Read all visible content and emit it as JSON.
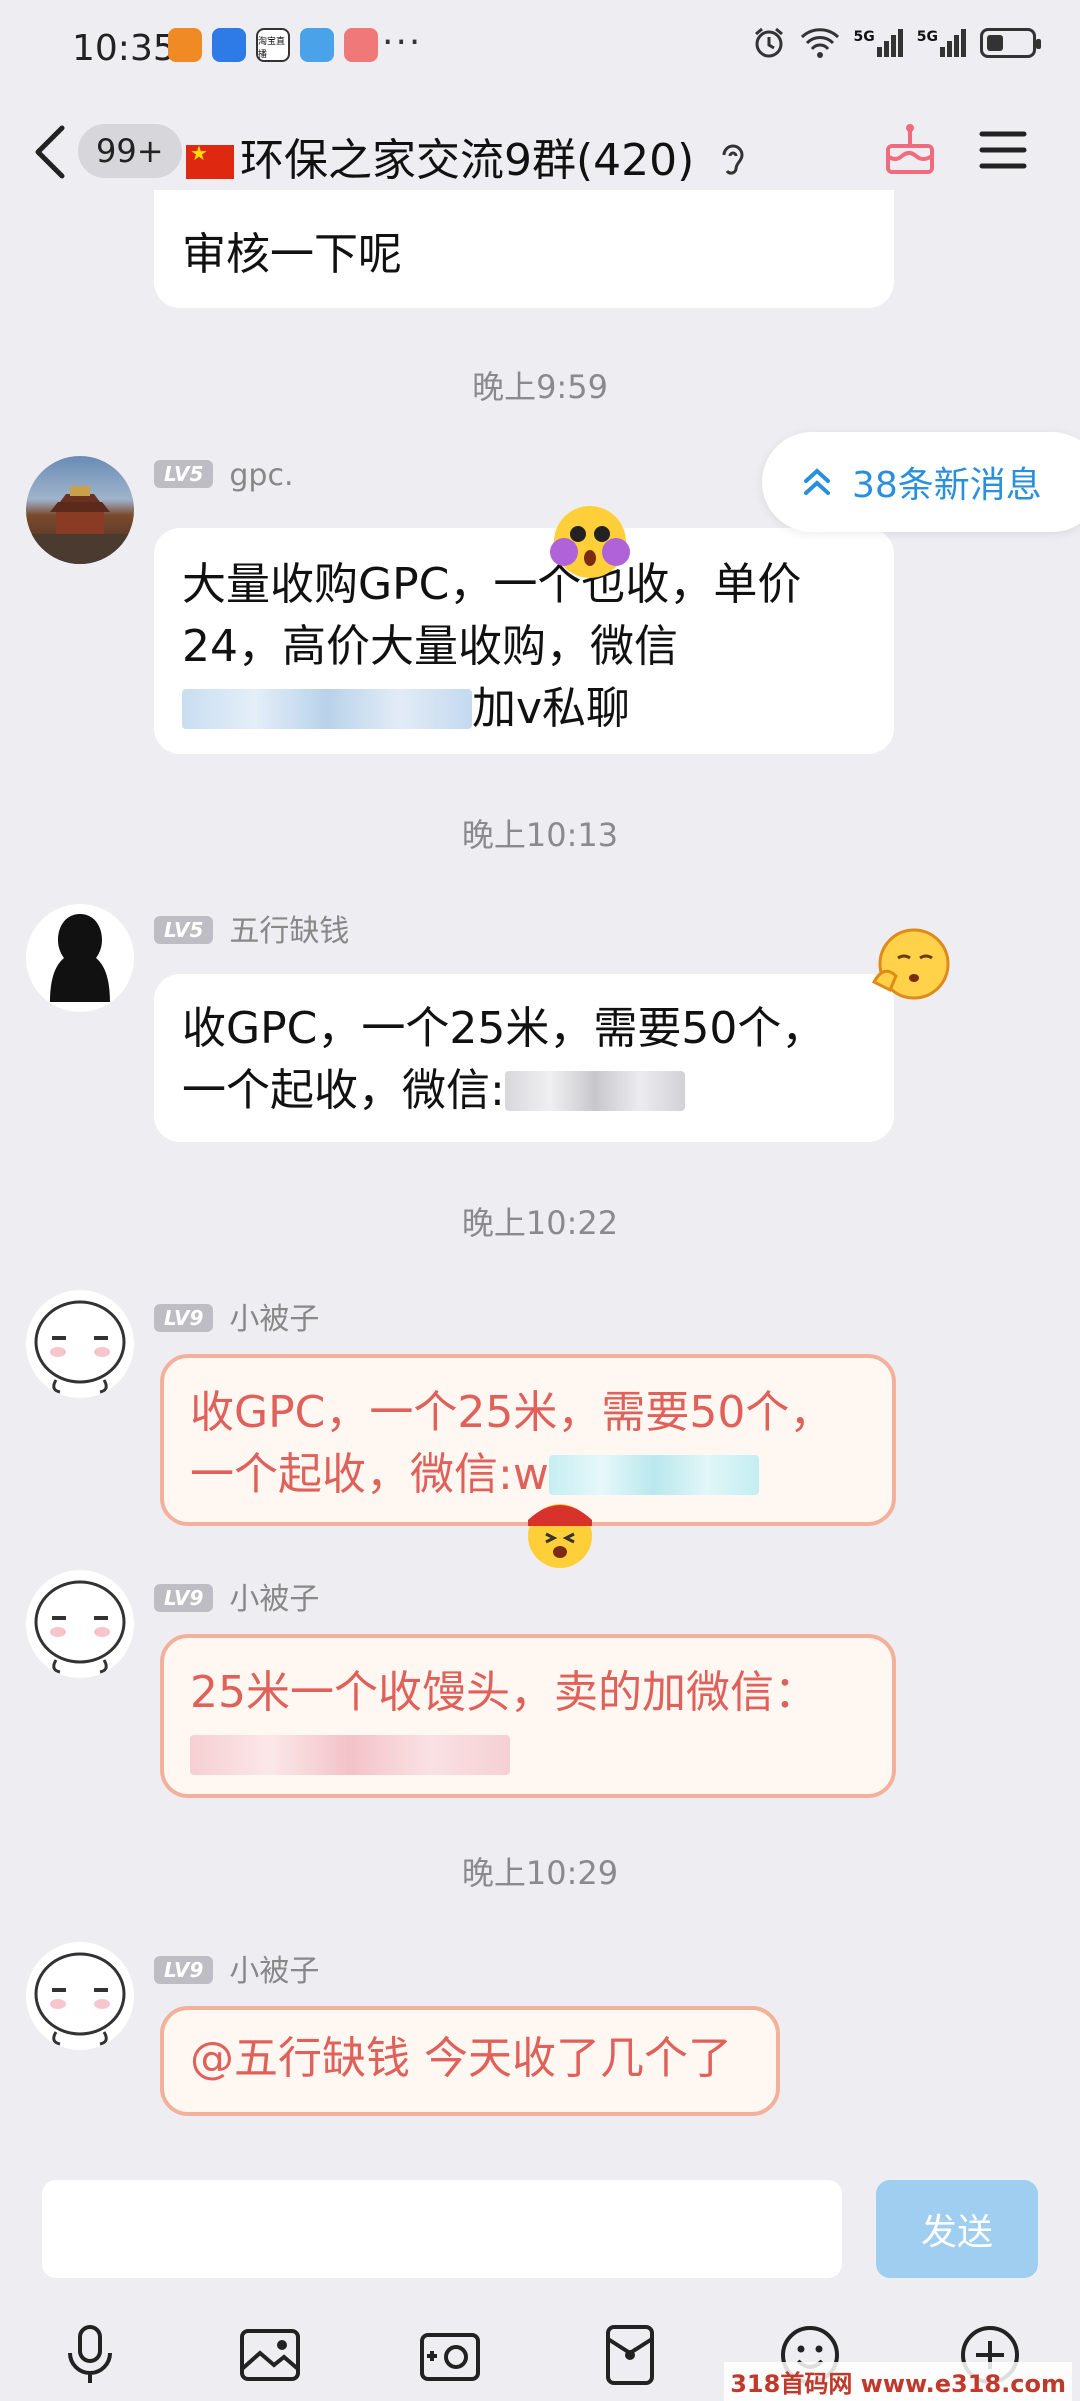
{
  "status_bar": {
    "time": "10:35",
    "app_label": "淘宝直播",
    "dots": "···",
    "net1": "5G",
    "net2": "5G"
  },
  "header": {
    "back_icon": "back-arrow-icon",
    "unread_badge": "99+",
    "group_title": "环保之家交流9群(420)",
    "ear_icon": "ear-icon",
    "cake_icon": "cake-icon",
    "menu_icon": "hamburger-menu-icon"
  },
  "new_messages_pill": "38条新消息",
  "messages": [
    {
      "text": "审核一下呢"
    },
    {
      "time": "晚上9:59"
    },
    {
      "level": "LV5",
      "user": "gpc.",
      "line1": "大量收购GPC，一个也收，单价",
      "line2": "24，高价大量收购，微信",
      "line3_tail": "加v私聊"
    },
    {
      "time": "晚上10:13"
    },
    {
      "level": "LV5",
      "user": "五行缺钱",
      "line1": "收GPC，一个25米，需要50个，",
      "line2_head": "一个起收，微信:"
    },
    {
      "time": "晚上10:22"
    },
    {
      "level": "LV9",
      "user": "小被子",
      "line1": "收GPC，一个25米，需要50个，",
      "line2_head": "一个起收，微信:w"
    },
    {
      "level": "LV9",
      "user": "小被子",
      "line1": "25米一个收馒头，卖的加微信："
    },
    {
      "time": "晚上10:29"
    },
    {
      "level": "LV9",
      "user": "小被子",
      "text": "@五行缺钱 今天收了几个了"
    }
  ],
  "input": {
    "send_label": "发送"
  },
  "toolbar_icons": [
    "microphone-icon",
    "image-icon",
    "camera-icon",
    "red-packet-icon",
    "emoji-icon",
    "plus-icon"
  ],
  "watermark": "318首码网 www.e318.com",
  "colors": {
    "background": "#eeedf2",
    "accent_blue": "#2a8fdc",
    "pink_text": "#e0605a",
    "pink_border": "#f3b09a",
    "send_button": "#9fcef0"
  }
}
